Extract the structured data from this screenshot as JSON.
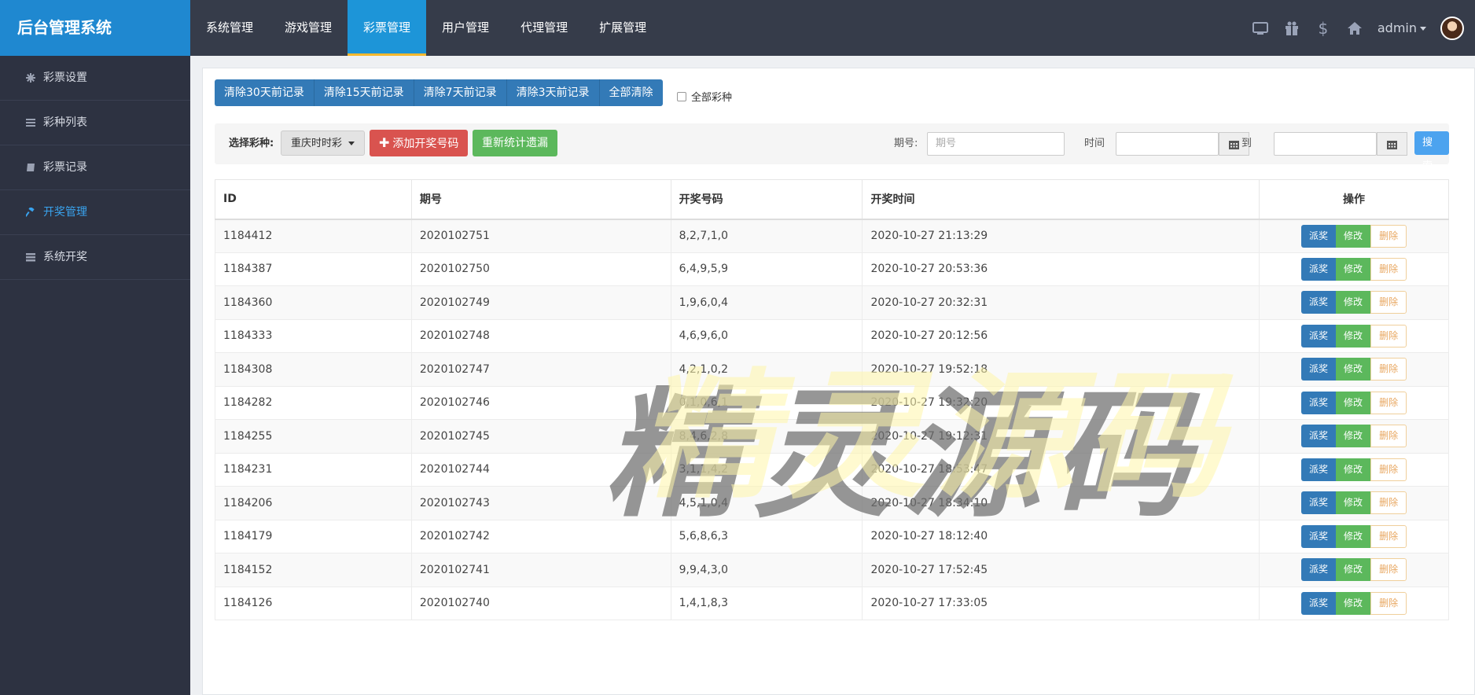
{
  "brand": "后台管理系统",
  "topnav": [
    "系统管理",
    "游戏管理",
    "彩票管理",
    "用户管理",
    "代理管理",
    "扩展管理"
  ],
  "topnav_active": "彩票管理",
  "user": {
    "name": "admin"
  },
  "top_icons": [
    "tv-icon",
    "gift-icon",
    "dollar-icon",
    "home-icon"
  ],
  "sidebar": [
    {
      "label": "彩票设置",
      "icon": "gear-icon"
    },
    {
      "label": "彩种列表",
      "icon": "list-icon"
    },
    {
      "label": "彩票记录",
      "icon": "book-icon"
    },
    {
      "label": "开奖管理",
      "icon": "gavel-icon",
      "active": true
    },
    {
      "label": "系统开奖",
      "icon": "server-icon"
    }
  ],
  "clear_buttons": [
    "清除30天前记录",
    "清除15天前记录",
    "清除7天前记录",
    "清除3天前记录",
    "全部清除"
  ],
  "all_types_label": "全部彩种",
  "toolbar": {
    "select_label": "选择彩种:",
    "select_value": "重庆时时彩",
    "add_label": "添加开奖号码",
    "recount_label": "重新统计遗漏",
    "issue_label": "期号:",
    "issue_placeholder": "期号",
    "time_label": "时间",
    "to_label": "到",
    "search_label": "搜索"
  },
  "table": {
    "headers": [
      "ID",
      "期号",
      "开奖号码",
      "开奖时间",
      "操作"
    ],
    "action_labels": {
      "pay": "派奖",
      "edit": "修改",
      "delete": "删除"
    },
    "rows": [
      [
        "1184412",
        "2020102751",
        "8,2,7,1,0",
        "2020-10-27 21:13:29"
      ],
      [
        "1184387",
        "2020102750",
        "6,4,9,5,9",
        "2020-10-27 20:53:36"
      ],
      [
        "1184360",
        "2020102749",
        "1,9,6,0,4",
        "2020-10-27 20:32:31"
      ],
      [
        "1184333",
        "2020102748",
        "4,6,9,6,0",
        "2020-10-27 20:12:56"
      ],
      [
        "1184308",
        "2020102747",
        "4,2,1,0,2",
        "2020-10-27 19:52:18"
      ],
      [
        "1184282",
        "2020102746",
        "0,1,0,6,1",
        "2020-10-27 19:32:20"
      ],
      [
        "1184255",
        "2020102745",
        "8,4,6,2,8",
        "2020-10-27 19:12:31"
      ],
      [
        "1184231",
        "2020102744",
        "3,1,1,4,2",
        "2020-10-27 18:53:47"
      ],
      [
        "1184206",
        "2020102743",
        "4,5,1,0,4",
        "2020-10-27 18:34:10"
      ],
      [
        "1184179",
        "2020102742",
        "5,6,8,6,3",
        "2020-10-27 18:12:40"
      ],
      [
        "1184152",
        "2020102741",
        "9,9,4,3,0",
        "2020-10-27 17:52:45"
      ],
      [
        "1184126",
        "2020102740",
        "1,4,1,8,3",
        "2020-10-27 17:33:05"
      ]
    ]
  },
  "watermark": "精灵源码",
  "colors": {
    "topbar": "#363c4a",
    "brand": "#1f88d0",
    "sidebar": "#2d3241",
    "primary": "#337ab7",
    "danger": "#d9534f",
    "success": "#5cb85c",
    "active_tab_underline": "#f5b82e"
  }
}
